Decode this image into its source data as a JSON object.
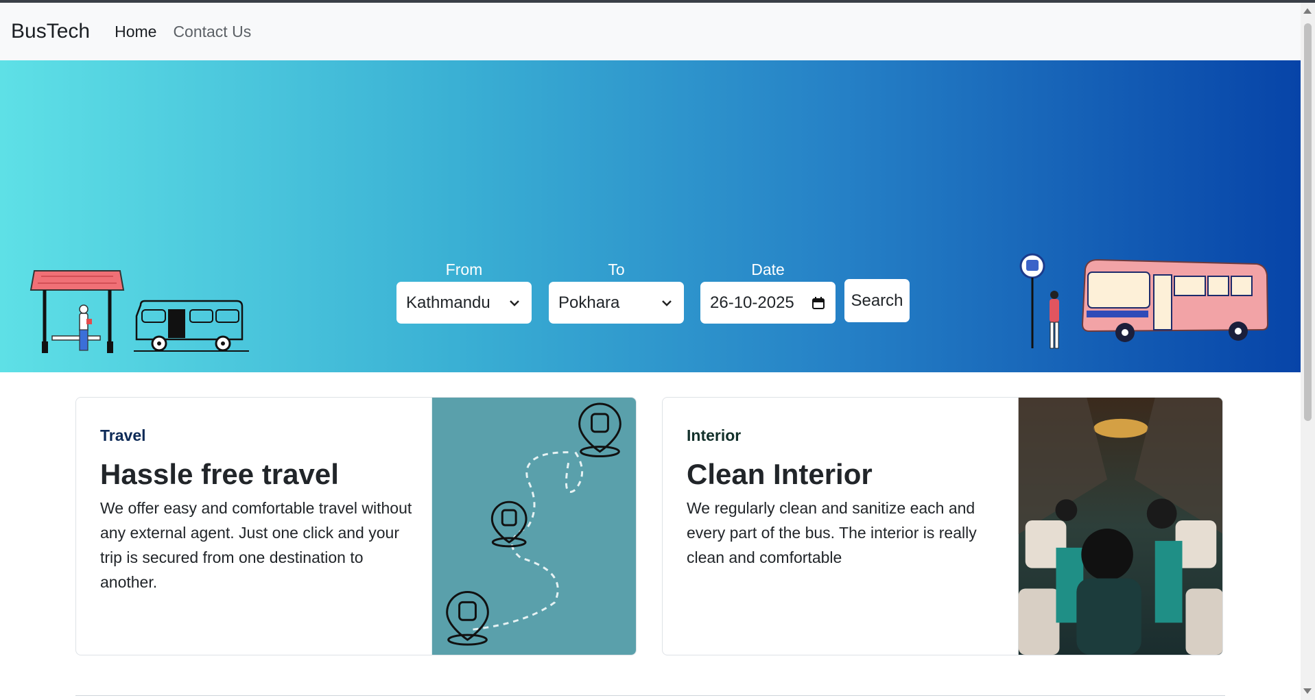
{
  "navbar": {
    "brand": "BusTech",
    "links": [
      {
        "label": "Home",
        "active": true
      },
      {
        "label": "Contact Us",
        "active": false
      }
    ]
  },
  "search": {
    "from_label": "From",
    "from_value": "Kathmandu",
    "to_label": "To",
    "to_value": "Pokhara",
    "date_label": "Date",
    "date_value": "26-10-2025",
    "button_label": "Search"
  },
  "cards": [
    {
      "subtitle": "Travel",
      "title": "Hassle free travel",
      "text": "We offer easy and comfortable travel without any external agent. Just one click and your trip is secured from one destination to another.",
      "image": "route-map-illustration"
    },
    {
      "subtitle": "Interior",
      "title": "Clean Interior",
      "text": "We regularly clean and sanitize each and every part of the bus. The interior is really clean and comfortable",
      "image": "bus-interior-photo"
    }
  ],
  "colors": {
    "hero_gradient_start": "#5ee0e6",
    "hero_gradient_end": "#0744a8",
    "navbar_bg": "#f8f9fa",
    "map_card_bg": "#5aa0ab"
  }
}
